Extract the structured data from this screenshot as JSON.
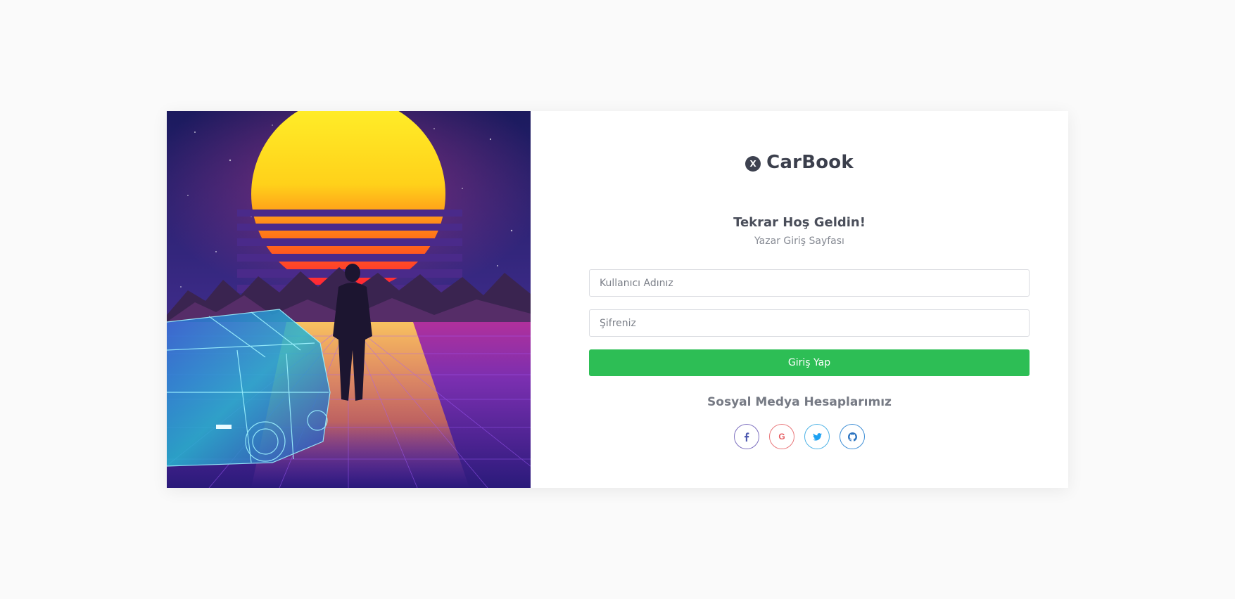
{
  "brand": {
    "name": "CarBook",
    "icon": "x-circle-icon",
    "icon_glyph": "X"
  },
  "hero": {
    "image": "synthwave-sunset-car-illustration"
  },
  "login": {
    "welcome": "Tekrar Hoş Geldin!",
    "subtitle": "Yazar Giriş Sayfası",
    "username_placeholder": "Kullanıcı Adınız",
    "password_placeholder": "Şifreniz",
    "submit_label": "Giriş Yap"
  },
  "social": {
    "title": "Sosyal Medya Hesaplarımız",
    "items": [
      {
        "name": "facebook",
        "glyph": "f",
        "icon": "facebook-icon"
      },
      {
        "name": "google",
        "glyph": "G",
        "icon": "google-icon"
      },
      {
        "name": "twitter",
        "glyph": "t",
        "icon": "twitter-icon"
      },
      {
        "name": "github",
        "glyph": "gh",
        "icon": "github-icon"
      }
    ]
  },
  "colors": {
    "page_bg": "#fafafa",
    "primary_button": "#2dbe55",
    "brand_text": "#3b3f4c"
  }
}
